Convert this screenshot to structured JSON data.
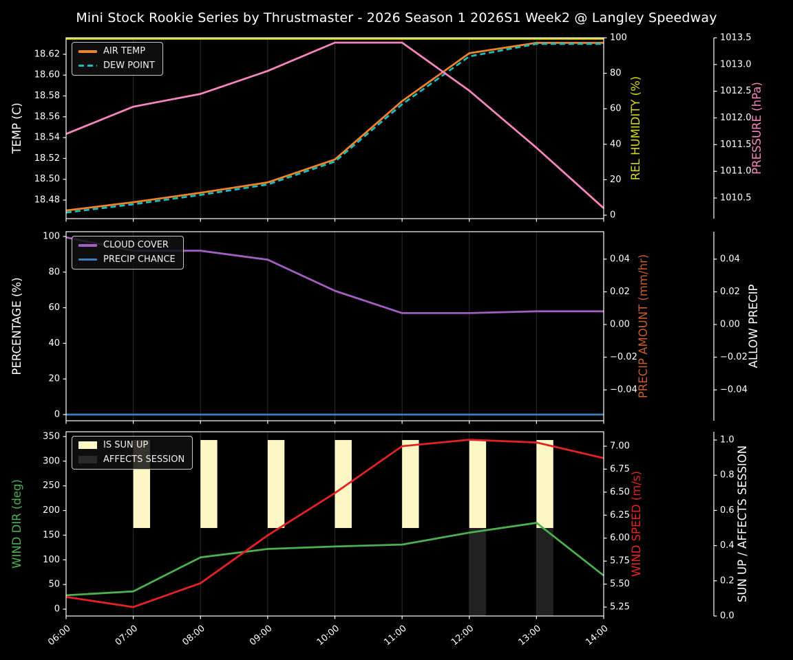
{
  "title": "Mini Stock Rookie Series by Thrustmaster - 2026 Season 1 2026S1 Week2 @ Langley Speedway",
  "x_axis": {
    "ticks": [
      {
        "v": 6,
        "t": "06:00"
      },
      {
        "v": 7,
        "t": "07:00"
      },
      {
        "v": 8,
        "t": "08:00"
      },
      {
        "v": 9,
        "t": "09:00"
      },
      {
        "v": 10,
        "t": "10:00"
      },
      {
        "v": 11,
        "t": "11:00"
      },
      {
        "v": 12,
        "t": "12:00"
      },
      {
        "v": 13,
        "t": "13:00"
      },
      {
        "v": 14,
        "t": "14:00"
      }
    ]
  },
  "chart_data": [
    {
      "name": "temperature-panel",
      "type": "line",
      "x": [
        6,
        7,
        8,
        9,
        10,
        11,
        12,
        13,
        14
      ],
      "axes": {
        "left": {
          "label": "TEMP (C)",
          "color": "#ffffff",
          "min": 18.4622,
          "max": 18.6358,
          "ticks": [
            {
              "v": 18.48,
              "t": "18.48"
            },
            {
              "v": 18.5,
              "t": "18.50"
            },
            {
              "v": 18.52,
              "t": "18.52"
            },
            {
              "v": 18.54,
              "t": "18.54"
            },
            {
              "v": 18.56,
              "t": "18.56"
            },
            {
              "v": 18.58,
              "t": "18.58"
            },
            {
              "v": 18.6,
              "t": "18.60"
            },
            {
              "v": 18.62,
              "t": "18.62"
            }
          ]
        },
        "right1": {
          "label": "REL HUMIDITY (%)",
          "color": "#d9d916",
          "min": -1.94,
          "max": 100,
          "ticks": [
            {
              "v": 0,
              "t": "0"
            },
            {
              "v": 20,
              "t": "20"
            },
            {
              "v": 40,
              "t": "40"
            },
            {
              "v": 60,
              "t": "60"
            },
            {
              "v": 80,
              "t": "80"
            },
            {
              "v": 100,
              "t": "100"
            }
          ]
        },
        "right2": {
          "label": "PRESSURE (hPa)",
          "color": "#f685bf",
          "min": 1010.114,
          "max": 1013.5,
          "ticks": [
            {
              "v": 1010.5,
              "t": "1010.5"
            },
            {
              "v": 1011.0,
              "t": "1011.0"
            },
            {
              "v": 1011.5,
              "t": "1011.5"
            },
            {
              "v": 1012.0,
              "t": "1012.0"
            },
            {
              "v": 1012.5,
              "t": "1012.5"
            },
            {
              "v": 1013.0,
              "t": "1013.0"
            },
            {
              "v": 1013.5,
              "t": "1013.5"
            }
          ]
        }
      },
      "series": [
        {
          "name": "AIR TEMP",
          "axis": "left",
          "color": "#f08228",
          "values": [
            18.47,
            18.478,
            18.487,
            18.497,
            18.519,
            18.575,
            18.621,
            18.631,
            18.631
          ]
        },
        {
          "name": "DEW POINT",
          "axis": "left",
          "color": "#1abdbd",
          "dash": "8 5",
          "values": [
            18.468,
            18.476,
            18.485,
            18.495,
            18.517,
            18.572,
            18.618,
            18.63,
            18.63
          ]
        },
        {
          "name": "REL HUMIDITY",
          "axis": "right1",
          "color": "#d9d916",
          "values": [
            99.5,
            99.5,
            99.5,
            99.5,
            99.5,
            99.5,
            99.5,
            99.5,
            99.5
          ]
        },
        {
          "name": "PRESSURE",
          "axis": "right2",
          "color": "#f685bf",
          "values": [
            1011.7,
            1012.21,
            1012.45,
            1012.88,
            1013.41,
            1013.41,
            1012.51,
            1011.44,
            1010.31
          ]
        }
      ],
      "legend": [
        {
          "label": "AIR TEMP",
          "color": "#f08228",
          "type": "line"
        },
        {
          "label": "DEW POINT",
          "color": "#1abdbd",
          "type": "dashed-line"
        }
      ]
    },
    {
      "name": "precipitation-panel",
      "type": "line",
      "x": [
        6,
        7,
        8,
        9,
        10,
        11,
        12,
        13,
        14
      ],
      "axes": {
        "left": {
          "label": "PERCENTAGE (%)",
          "color": "#ffffff",
          "min": -3.47,
          "max": 102.7,
          "ticks": [
            {
              "v": 0,
              "t": "0"
            },
            {
              "v": 20,
              "t": "20"
            },
            {
              "v": 40,
              "t": "40"
            },
            {
              "v": 60,
              "t": "60"
            },
            {
              "v": 80,
              "t": "80"
            },
            {
              "v": 100,
              "t": "100"
            }
          ]
        },
        "right1": {
          "label": "PRECIP AMOUNT (mm/hr)",
          "color": "#c65d2e",
          "min": -0.0589,
          "max": 0.0568,
          "ticks": [
            {
              "v": -0.04,
              "t": "−0.04"
            },
            {
              "v": -0.02,
              "t": "−0.02"
            },
            {
              "v": 0.0,
              "t": "0.00"
            },
            {
              "v": 0.02,
              "t": "0.02"
            },
            {
              "v": 0.04,
              "t": "0.04"
            }
          ]
        },
        "right2": {
          "label": "ALLOW PRECIP",
          "color": "#ffffff",
          "min": -0.0589,
          "max": 0.0568,
          "ticks": [
            {
              "v": -0.04,
              "t": "−0.04"
            },
            {
              "v": -0.02,
              "t": "−0.02"
            },
            {
              "v": 0.0,
              "t": "0.00"
            },
            {
              "v": 0.02,
              "t": "0.02"
            },
            {
              "v": 0.04,
              "t": "0.04"
            }
          ]
        }
      },
      "series": [
        {
          "name": "CLOUD COVER",
          "axis": "left",
          "color": "#a35ec2",
          "values": [
            99.5,
            92,
            92,
            87,
            69.5,
            57,
            57,
            58,
            58
          ]
        },
        {
          "name": "PRECIP CHANCE",
          "axis": "left",
          "color": "#3d7fc1",
          "values": [
            0,
            0,
            0,
            0,
            0,
            0,
            0,
            0,
            0
          ]
        }
      ],
      "legend": [
        {
          "label": "CLOUD COVER",
          "color": "#a35ec2",
          "type": "line"
        },
        {
          "label": "PRECIP CHANCE",
          "color": "#3d7fc1",
          "type": "line"
        }
      ]
    },
    {
      "name": "wind-panel",
      "type": "line+bar",
      "x": [
        6,
        7,
        8,
        9,
        10,
        11,
        12,
        13,
        14
      ],
      "axes": {
        "left": {
          "label": "WIND DIR (deg)",
          "color": "#4caf50",
          "min": -13.9,
          "max": 359.7,
          "ticks": [
            {
              "v": 0,
              "t": "0"
            },
            {
              "v": 50,
              "t": "50"
            },
            {
              "v": 100,
              "t": "100"
            },
            {
              "v": 150,
              "t": "150"
            },
            {
              "v": 200,
              "t": "200"
            },
            {
              "v": 250,
              "t": "250"
            },
            {
              "v": 300,
              "t": "300"
            },
            {
              "v": 350,
              "t": "350"
            }
          ]
        },
        "right1": {
          "label": "WIND SPEED (m/s)",
          "color": "#e52222",
          "min": 5.153,
          "max": 7.157,
          "ticks": [
            {
              "v": 5.25,
              "t": "5.25"
            },
            {
              "v": 5.5,
              "t": "5.50"
            },
            {
              "v": 5.75,
              "t": "5.75"
            },
            {
              "v": 6.0,
              "t": "6.00"
            },
            {
              "v": 6.25,
              "t": "6.25"
            },
            {
              "v": 6.5,
              "t": "6.50"
            },
            {
              "v": 6.75,
              "t": "6.75"
            },
            {
              "v": 7.0,
              "t": "7.00"
            }
          ]
        },
        "right2": {
          "label": "SUN UP / AFFECTS SESSION",
          "color": "#ffffff",
          "min": 0,
          "max": 1.047,
          "ticks": [
            {
              "v": 0.0,
              "t": "0.0"
            },
            {
              "v": 0.2,
              "t": "0.2"
            },
            {
              "v": 0.4,
              "t": "0.4"
            },
            {
              "v": 0.6,
              "t": "0.6"
            },
            {
              "v": 0.8,
              "t": "0.8"
            },
            {
              "v": 1.0,
              "t": "1.0"
            }
          ]
        }
      },
      "bars": [
        {
          "name": "is-sun-up",
          "axis": "right2",
          "color": "#fcf7c5",
          "hours": [
            7,
            8,
            9,
            10,
            11,
            12,
            13
          ],
          "y0": 0.5,
          "y1": 1.0,
          "width_hours": 0.25
        },
        {
          "name": "affects-session",
          "axis": "right2",
          "color": "#212121",
          "hours": [
            12,
            13
          ],
          "y0": 0.0,
          "y1": 0.5,
          "width_hours": 0.25
        }
      ],
      "series": [
        {
          "name": "WIND DIR",
          "axis": "left",
          "color": "#4caf50",
          "values": [
            28,
            36,
            105,
            122,
            127,
            131,
            155,
            175,
            68
          ]
        },
        {
          "name": "WIND SPEED",
          "axis": "right1",
          "color": "#e52222",
          "values": [
            5.36,
            5.25,
            5.51,
            6.03,
            6.49,
            7.0,
            7.07,
            7.04,
            6.87
          ]
        }
      ],
      "legend": [
        {
          "label": "IS SUN UP",
          "color": "#fcf7c5",
          "type": "patch"
        },
        {
          "label": "AFFECTS SESSION",
          "color": "#2a2a28",
          "type": "patch"
        }
      ]
    }
  ]
}
